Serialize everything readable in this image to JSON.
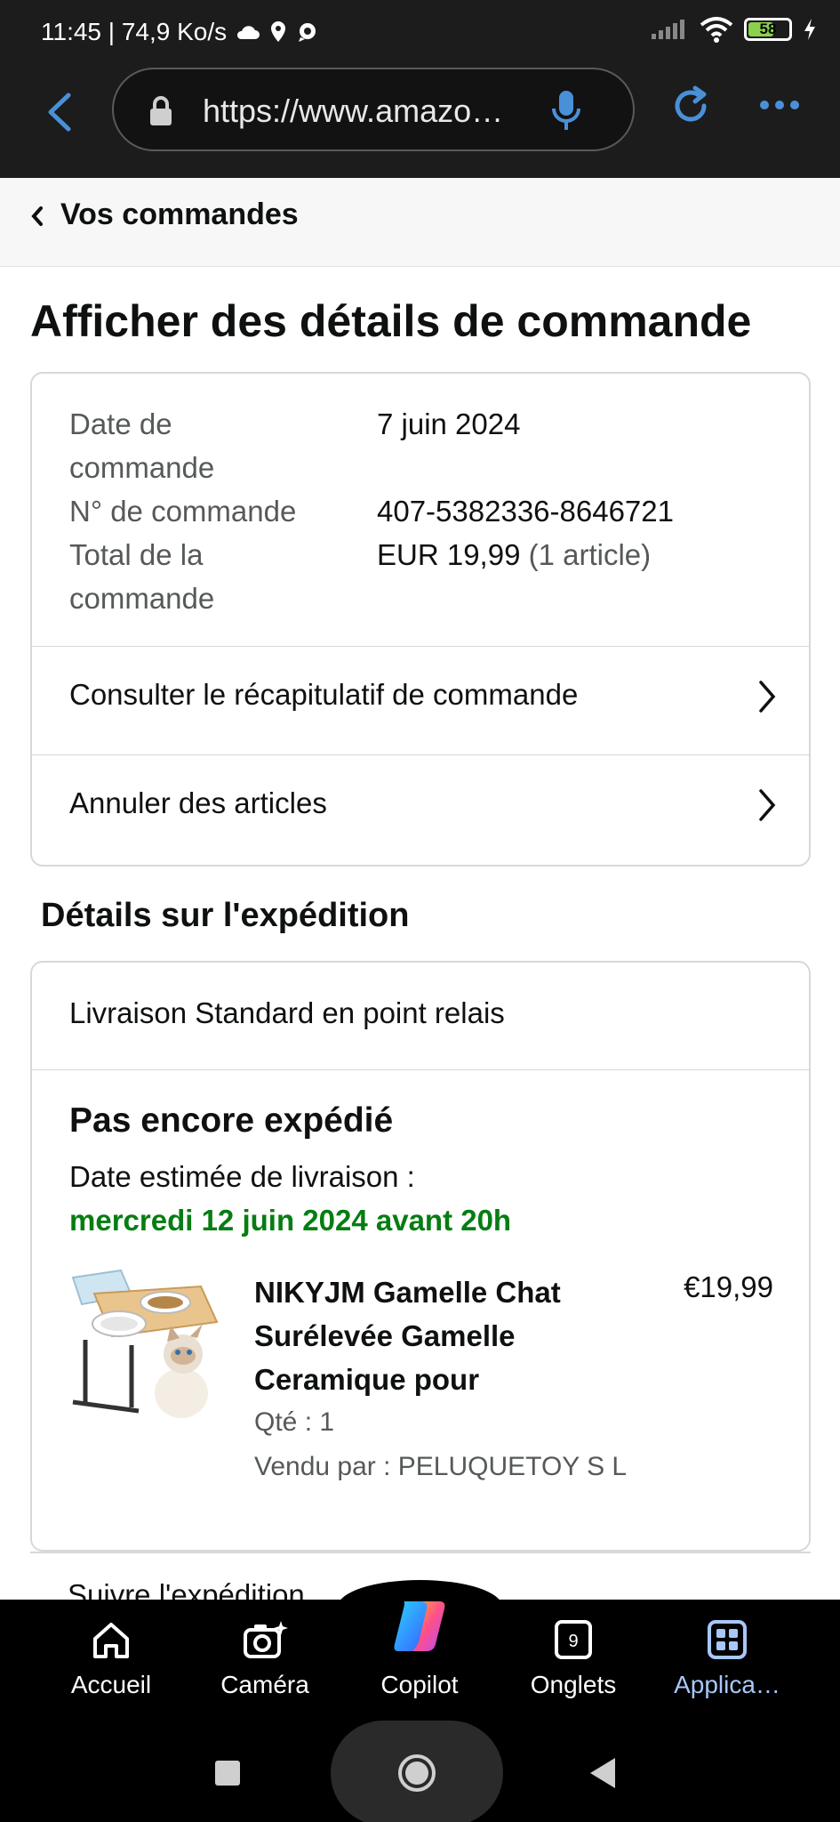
{
  "status_bar": {
    "time_speed": "11:45 | 74,9 Ko/s",
    "battery": "58"
  },
  "browser": {
    "url": "https://www.amazo…"
  },
  "nav": {
    "back_label": "Vos commandes"
  },
  "page": {
    "title": "Afficher des détails de commande"
  },
  "order": {
    "date_label_l1": "Date de",
    "date_label_l2": "commande",
    "date_value": "7 juin 2024",
    "number_label": "N° de commande",
    "number_value": "407-5382336-8646721",
    "total_label_l1": "Total de la",
    "total_label_l2": "commande",
    "total_value": "EUR 19,99",
    "total_count": "(1 article)",
    "summary_link": "Consulter le récapitulatif de commande",
    "cancel_link": "Annuler des articles"
  },
  "shipping": {
    "section_title": "Détails sur l'expédition",
    "method": "Livraison Standard en point relais",
    "status": "Pas encore expédié",
    "estimate_label": "Date estimée de livraison :",
    "estimate_date": "mercredi 12 juin 2024 avant 20h",
    "item": {
      "name_l1": "NIKYJM Gamelle Chat",
      "name_l2": "Surélevée Gamelle",
      "name_l3": "Ceramique pour",
      "price": "€19,99",
      "qty": "Qté : 1",
      "seller": "Vendu par : PELUQUETOY S L"
    },
    "track_link": "Suivre l'expédition"
  },
  "toolbar": {
    "home": "Accueil",
    "camera": "Caméra",
    "copilot": "Copilot",
    "tabs": "Onglets",
    "tabs_count": "9",
    "apps": "Applica…"
  },
  "colors": {
    "accent_green": "#067d12",
    "active_tab": "#a8c7fa",
    "browser_bg": "#1c1c1c"
  }
}
